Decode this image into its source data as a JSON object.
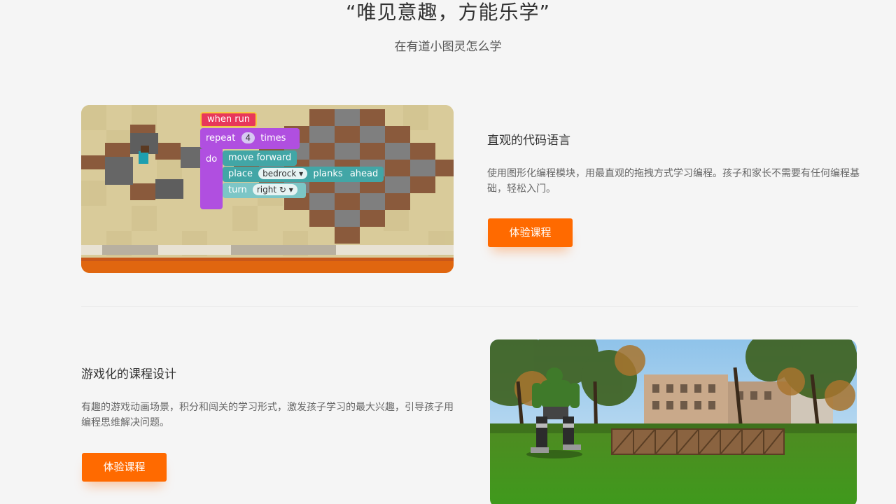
{
  "hero": {
    "title": "“唯见意趣，方能乐学”",
    "subtitle": "在有道小图灵怎么学"
  },
  "feature1": {
    "title": "直观的代码语言",
    "description": "使用图形化编程模块，用最直观的拖拽方式学习编程。孩子和家长不需要有任何编程基础，轻松入门。",
    "button_label": "体验课程",
    "code_blocks": {
      "when_run": "when run",
      "repeat": "repeat",
      "repeat_count": "4",
      "times": "times",
      "do": "do",
      "move_forward": "move forward",
      "place": "place",
      "place_value": "bedrock",
      "planks": "planks",
      "ahead": "ahead",
      "turn": "turn",
      "turn_value": "right ↻"
    }
  },
  "feature2": {
    "title": "游戏化的课程设计",
    "description": "有趣的游戏动画场景，积分和闯关的学习形式，激发孩子学习的最大兴趣，引导孩子用编程思维解决问题。",
    "button_label": "体验课程"
  },
  "colors": {
    "accent": "#ff6a00",
    "when_run": "#e8375a",
    "repeat": "#b04fe0",
    "action": "#42a6a6"
  }
}
